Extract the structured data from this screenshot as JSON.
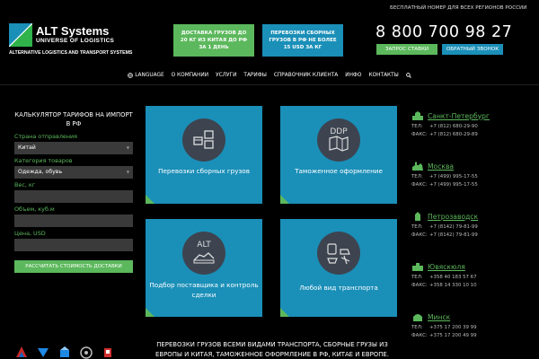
{
  "header": {
    "logo": {
      "title": "ALT Systems",
      "subtitle": "UNIVERSE OF LOGISTICS",
      "tagline": "ALTERNATIVE LOGISTICS AND TRANSPORT SYSTEMS"
    },
    "promo_green": "ДОСТАВКА ГРУЗОВ ДО 20 КГ ИЗ КИТАЯ ДО РФ ЗА 1 ДЕНЬ",
    "promo_blue": "ПЕРЕВОЗКИ СБОРНЫХ ГРУЗОВ В РФ НЕ БОЛЕЕ 15 USD ЗА КГ",
    "free_number_label": "БЕСПЛАТНЫЙ НОМЕР ДЛЯ ВСЕХ РЕГИОНОВ РОССИИ",
    "phone": "8 800 700 98 27",
    "request_button": "ЗАПРОС СТАВКИ",
    "callback_button": "ОБРАТНЫЙ ЗВОНОК"
  },
  "nav": {
    "items": [
      "LANGUAGE",
      "О КОМПАНИИ",
      "УСЛУГИ",
      "ТАРИФЫ",
      "СПРАВОЧНИК КЛИЕНТА",
      "ИНФО",
      "КОНТАКТЫ"
    ]
  },
  "calculator": {
    "title": "КАЛЬКУЛЯТОР ТАРИФОВ НА ИМПОРТ В РФ",
    "origin_label": "Страна отправления",
    "origin_value": "Китай",
    "category_label": "Категория товаров",
    "category_value": "Одежда, обувь",
    "weight_label": "Вес, кг",
    "weight_value": "",
    "volume_label": "Объем, куб.м",
    "volume_value": "",
    "price_label": "Цена, USD",
    "price_value": "",
    "submit": "РАССЧИТАТЬ СТОИМОСТЬ ДОСТАВКИ"
  },
  "services": [
    {
      "label": "Перевозки сборных грузов",
      "icon": "boxes-icon"
    },
    {
      "label": "Таможенное оформление",
      "icon": "ddp-map-icon",
      "icon_text": "DDP"
    },
    {
      "label": "Подбор поставщика и контроль сделки",
      "icon": "alt-supplier-icon",
      "icon_text": "ALT"
    },
    {
      "label": "Любой вид транспорта",
      "icon": "transport-icon"
    }
  ],
  "offices": [
    {
      "city": "Санкт-Петербург",
      "tel": "+7 (812) 680-29-90",
      "fax": "+7 (812) 680-29-89"
    },
    {
      "city": "Москва",
      "tel": "+7 (499) 995-17-55",
      "fax": "+7 (499) 995-17-55"
    },
    {
      "city": "Петрозаводск",
      "tel": "+7 (8142) 79-81-99",
      "fax": "+7 (8142) 79-81-99"
    },
    {
      "city": "Ювяскюля",
      "tel": "+358 40 183 57 67",
      "fax": "+358 14 330 10 10"
    },
    {
      "city": "Минск",
      "tel": "+375 17 200 39 99",
      "fax": "+375 17 200 49 99"
    }
  ],
  "office_labels": {
    "tel": "ТЕЛ:",
    "fax": "ФАКС:"
  },
  "bottom_text": "ПЕРЕВОЗКИ ГРУЗОВ ВСЕМИ ВИДАМИ ТРАНСПОРТА, СБОРНЫЕ ГРУЗЫ ИЗ ЕВРОПЫ И КИТАЯ, ТАМОЖЕННОЕ ОФОРМЛЕНИЕ В РФ, КИТАЕ И ЕВРОПЕ.",
  "colors": {
    "green": "#5cb85c",
    "blue": "#1a8fb8",
    "background": "#000000",
    "field": "#3a3a3a"
  }
}
